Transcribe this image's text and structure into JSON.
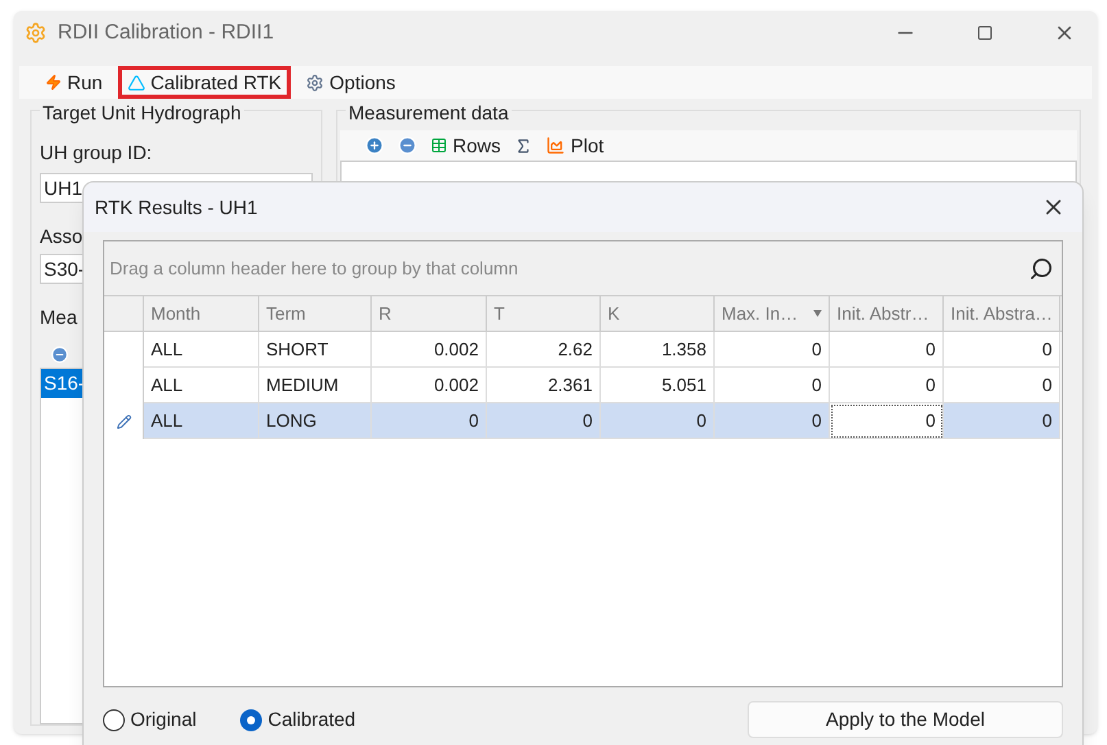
{
  "window": {
    "title": "RDII Calibration - RDII1"
  },
  "toolbar": [
    {
      "label": "Run",
      "kind": "run",
      "highlighted": false
    },
    {
      "label": "Calibrated RTK",
      "kind": "chart",
      "highlighted": true
    },
    {
      "label": "Options",
      "kind": "options",
      "highlighted": false
    }
  ],
  "target_unit_hydrograph": {
    "title": "Target Unit Hydrograph",
    "uh_group_label": "UH group ID:",
    "uh_group_value": "UH1",
    "assoc_label": "Asso",
    "assoc_value": "S30-",
    "meas_label": "Mea",
    "list_items": [
      {
        "text": "S16-",
        "selected": true
      }
    ]
  },
  "measurement_data": {
    "title": "Measurement data",
    "toolbar": [
      {
        "kind": "add"
      },
      {
        "kind": "remove"
      },
      {
        "kind": "rows",
        "label": "Rows"
      },
      {
        "kind": "fx"
      },
      {
        "kind": "plot",
        "label": "Plot"
      }
    ]
  },
  "dialog": {
    "title": "RTK Results - UH1",
    "group_panel": "Drag a column header here to group by that column",
    "columns": [
      {
        "label": "Month",
        "kind": "text",
        "filtered": false
      },
      {
        "label": "Term",
        "kind": "text",
        "filtered": false
      },
      {
        "label": "R",
        "kind": "number",
        "filtered": false
      },
      {
        "label": "T",
        "kind": "number",
        "filtered": false
      },
      {
        "label": "K",
        "kind": "number",
        "filtered": false
      },
      {
        "label": "Max. In…",
        "kind": "number",
        "filtered": true
      },
      {
        "label": "Init. Abstr…",
        "kind": "number",
        "filtered": false
      },
      {
        "label": "Init. Abstra…",
        "kind": "number",
        "filtered": false
      }
    ],
    "rows": [
      {
        "selected": false,
        "editing": false,
        "cells": [
          {
            "text": "ALL",
            "focused": false
          },
          {
            "text": "SHORT",
            "focused": false
          },
          {
            "text": "0.002",
            "focused": false
          },
          {
            "text": "2.62",
            "focused": false
          },
          {
            "text": "1.358",
            "focused": false
          },
          {
            "text": "0",
            "focused": false
          },
          {
            "text": "0",
            "focused": false
          },
          {
            "text": "0",
            "focused": false
          }
        ]
      },
      {
        "selected": false,
        "editing": false,
        "cells": [
          {
            "text": "ALL",
            "focused": false
          },
          {
            "text": "MEDIUM",
            "focused": false
          },
          {
            "text": "0.002",
            "focused": false
          },
          {
            "text": "2.361",
            "focused": false
          },
          {
            "text": "5.051",
            "focused": false
          },
          {
            "text": "0",
            "focused": false
          },
          {
            "text": "0",
            "focused": false
          },
          {
            "text": "0",
            "focused": false
          }
        ]
      },
      {
        "selected": true,
        "editing": true,
        "cells": [
          {
            "text": "ALL",
            "focused": false
          },
          {
            "text": "LONG",
            "focused": false
          },
          {
            "text": "0",
            "focused": false
          },
          {
            "text": "0",
            "focused": false
          },
          {
            "text": "0",
            "focused": false
          },
          {
            "text": "0",
            "focused": false
          },
          {
            "text": "0",
            "focused": true
          },
          {
            "text": "0",
            "focused": false
          }
        ]
      }
    ],
    "radios": [
      {
        "label": "Original",
        "selected": false
      },
      {
        "label": "Calibrated",
        "selected": true
      }
    ],
    "apply_button": "Apply to the Model"
  }
}
